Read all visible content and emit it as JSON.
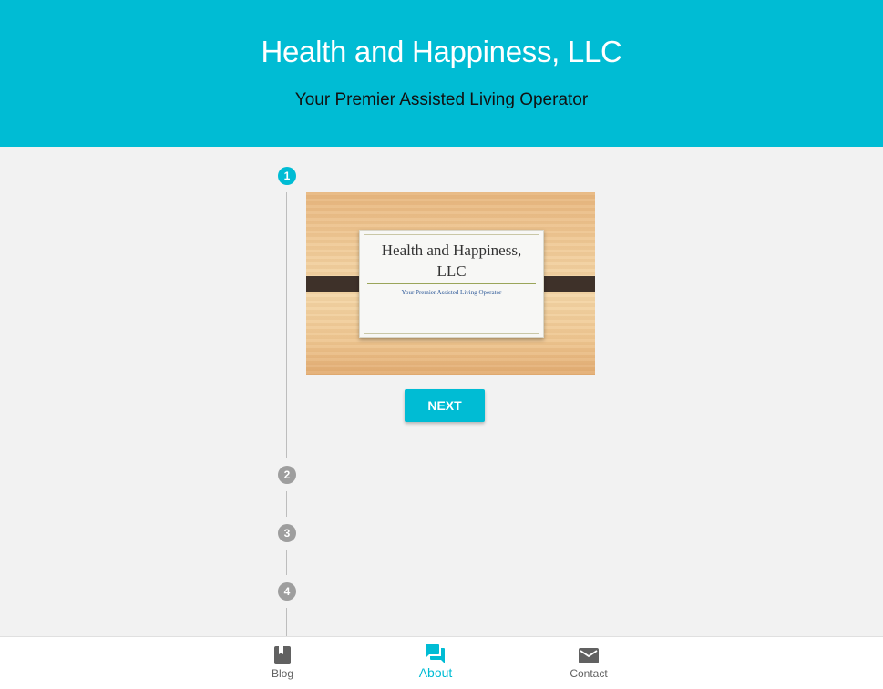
{
  "header": {
    "title": "Health and Happiness, LLC",
    "subtitle": "Your Premier Assisted Living Operator"
  },
  "stepper": {
    "steps": [
      {
        "number": "1",
        "state": "active"
      },
      {
        "number": "2",
        "state": "inactive"
      },
      {
        "number": "3",
        "state": "inactive"
      },
      {
        "number": "4",
        "state": "inactive"
      }
    ],
    "slide": {
      "title_line1": "Health and Happiness,",
      "title_line2": "LLC",
      "subtitle": "Your Premier Assisted Living Operator"
    },
    "next_label": "NEXT"
  },
  "bottom_nav": {
    "items": [
      {
        "label": "Blog",
        "icon": "book-icon",
        "active": false
      },
      {
        "label": "About",
        "icon": "forum-icon",
        "active": true
      },
      {
        "label": "Contact",
        "icon": "mail-icon",
        "active": false
      }
    ]
  },
  "colors": {
    "accent": "#00bcd4",
    "inactive_step": "#9e9e9e",
    "background": "#f2f2f2",
    "nav_icon": "#616161"
  }
}
